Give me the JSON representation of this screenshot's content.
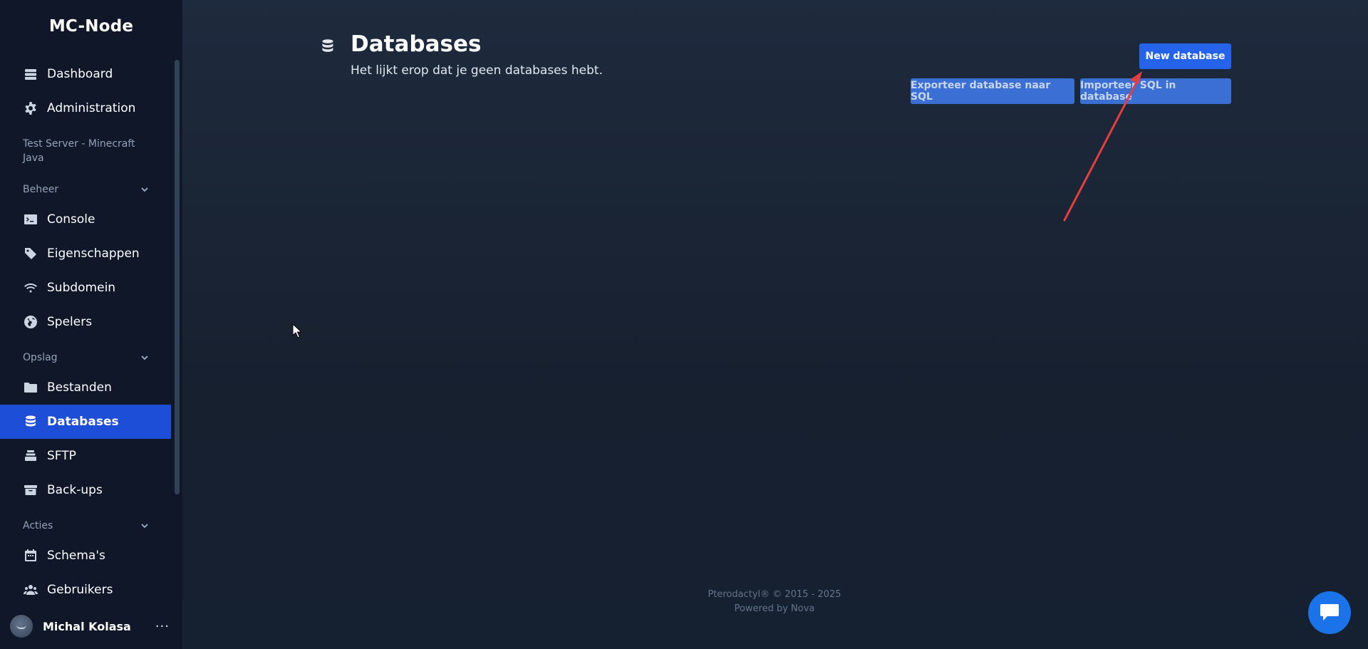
{
  "app": {
    "brand": "MC-Node"
  },
  "sidebar": {
    "top_items": [
      {
        "label": "Dashboard",
        "icon": "server-stack-icon"
      },
      {
        "label": "Administration",
        "icon": "gear-icon"
      }
    ],
    "server_name": "Test Server - Minecraft Java",
    "sections": {
      "beheer": "Beheer",
      "opslag": "Opslag",
      "acties": "Acties"
    },
    "beheer_items": [
      {
        "label": "Console",
        "icon": "terminal-icon"
      },
      {
        "label": "Eigenschappen",
        "icon": "tag-icon"
      },
      {
        "label": "Subdomein",
        "icon": "wifi-icon"
      },
      {
        "label": "Spelers",
        "icon": "globe-icon"
      }
    ],
    "opslag_items": [
      {
        "label": "Bestanden",
        "icon": "folder-icon"
      },
      {
        "label": "Databases",
        "icon": "database-icon",
        "active": true
      },
      {
        "label": "SFTP",
        "icon": "layers-icon"
      },
      {
        "label": "Back-ups",
        "icon": "archive-icon"
      }
    ],
    "acties_items": [
      {
        "label": "Schema's",
        "icon": "calendar-icon"
      },
      {
        "label": "Gebruikers",
        "icon": "users-icon"
      }
    ],
    "user": {
      "name": "Michal Kolasa",
      "menu": "···"
    }
  },
  "main": {
    "title": "Databases",
    "subtitle": "Het lijkt erop dat je geen databases hebt.",
    "buttons": {
      "new_database": "New database",
      "export": "Exporteer database naar SQL",
      "import": "Importeer SQL in database"
    },
    "footer": {
      "copyright": "Pterodactyl® © 2015 - 2025",
      "powered": "Powered by Nova"
    }
  },
  "colors": {
    "sidebar_bg": "#0f1729",
    "active_item": "#1d4ed8",
    "primary_button": "#2563eb",
    "annotation_arrow": "#e53e3e",
    "chat_bubble": "#1a73e8"
  }
}
